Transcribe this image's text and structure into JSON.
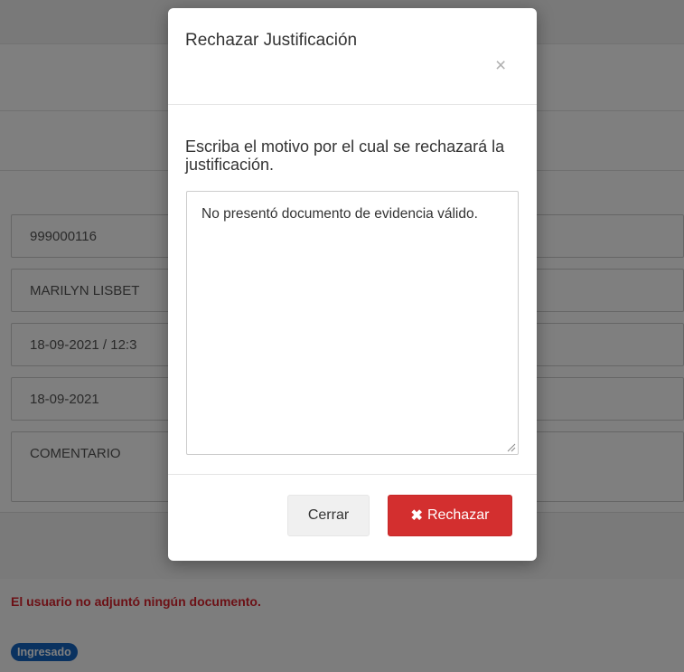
{
  "background": {
    "fields": [
      {
        "value": "999000116"
      },
      {
        "value": "MARILYN LISBET"
      },
      {
        "value": "18-09-2021  / 12:3"
      },
      {
        "value": "18-09-2021"
      },
      {
        "value": "COMENTARIO"
      }
    ],
    "error_message": "El usuario no adjuntó ningún documento.",
    "status_badge": "Ingresado"
  },
  "modal": {
    "title": "Rechazar Justificación",
    "close_glyph": "×",
    "prompt": "Escriba el motivo por el cual se rechazará la justificación.",
    "reason_value": "No presentó documento de evidencia válido.",
    "buttons": {
      "close_label": "Cerrar",
      "reject_icon": "x-icon",
      "reject_label": "Rechazar"
    }
  },
  "colors": {
    "error": "#d9232d",
    "badge": "#1565c0",
    "reject_button": "#d32f2f"
  }
}
